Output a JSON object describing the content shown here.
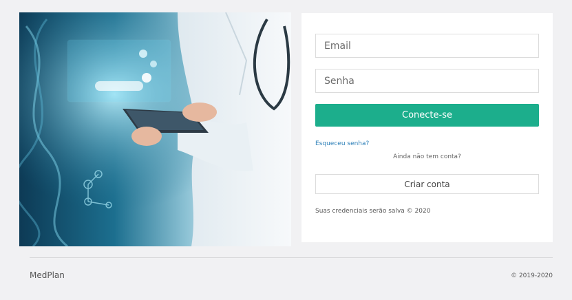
{
  "hero": {
    "icon": "doctor-tablet-illustration"
  },
  "login": {
    "email_placeholder": "Email",
    "password_placeholder": "Senha",
    "submit_label": "Conecte-se",
    "forgot_label": "Esqueceu senha?",
    "no_account_text": "Ainda não tem conta?",
    "create_account_label": "Criar conta",
    "credentials_note": "Suas credenciais serão salva © 2020"
  },
  "footer": {
    "brand": "MedPlan",
    "copyright": "© 2019-2020"
  },
  "colors": {
    "primary": "#1cae8c",
    "link": "#2c7fb8",
    "background": "#f1f1f3"
  }
}
